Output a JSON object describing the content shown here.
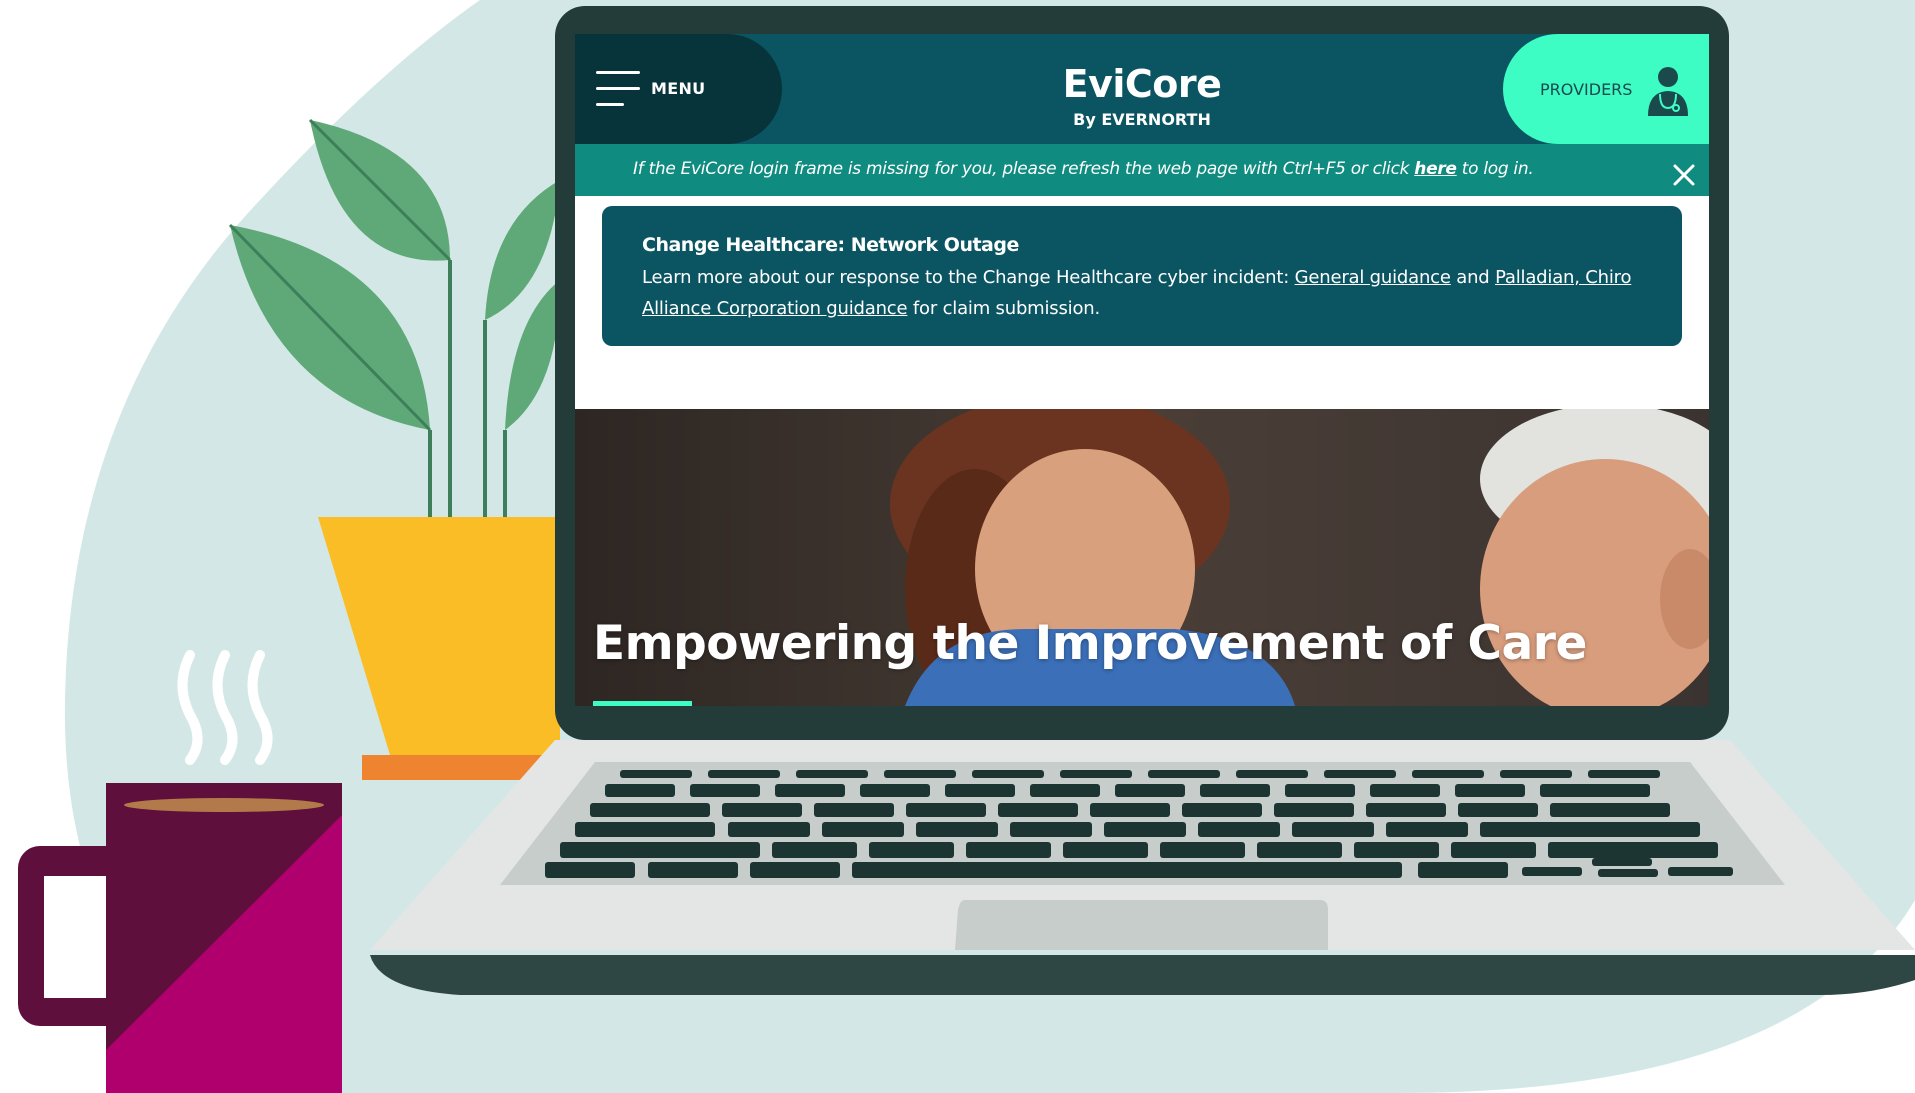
{
  "colors": {
    "background_blob": "#d3e8e6",
    "header_teal": "#0b5563",
    "menu_dark": "#06343a",
    "providers_mint": "#3dfcc4",
    "notice_teal": "#0f8b80",
    "pot_yellow": "#fbbd25",
    "pot_orange": "#ee8330",
    "leaf_green": "#5fa878",
    "mug_plum": "#5e0f3c",
    "mug_magenta": "#b0006e",
    "laptop_bezel": "#233b39",
    "laptop_silver": "#e4e6e5",
    "keyboard_keys": "#1c3533"
  },
  "header": {
    "menu_label": "MENU",
    "menu_icon": "hamburger-icon",
    "logo_main": "EviCore",
    "logo_sub": "By EVERNORTH",
    "providers_label": "PROVIDERS",
    "providers_icon": "doctor-icon"
  },
  "notice": {
    "text_before": "If the EviCore login frame is missing for you, please refresh the web page with Ctrl+F5 or click ",
    "link": "here",
    "text_after": " to log in.",
    "close_icon": "close-icon"
  },
  "alert": {
    "title": "Change Healthcare: Network Outage",
    "body_before": "Learn more about our response to the Change Healthcare cyber incident: ",
    "link1": "General guidance",
    "between": " and ",
    "link2": "Palladian, Chiro Alliance Corporation guidance",
    "body_after": " for claim submission."
  },
  "hero": {
    "title": "Empowering the Improvement of Care",
    "image": "smiling-nurse-and-elderly-patient-photo"
  }
}
